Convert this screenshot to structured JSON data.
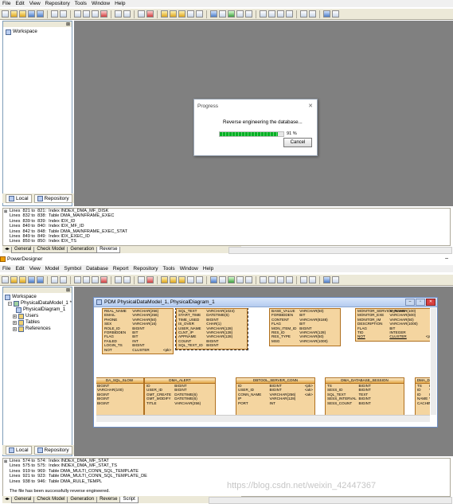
{
  "menu_top": [
    "File",
    "Edit",
    "View",
    "Repository",
    "Tools",
    "Window",
    "Help"
  ],
  "app_title": "PowerDesigner",
  "menu_bottom": [
    "File",
    "Edit",
    "View",
    "Model",
    "Symbol",
    "Database",
    "Report",
    "Repository",
    "Tools",
    "Window",
    "Help"
  ],
  "browser_top": {
    "root": "Workspace"
  },
  "browser_bottom": {
    "root": "Workspace",
    "model": "PhysicalDataModel_1 *",
    "items": [
      "PhysicalDiagram_1",
      "Users",
      "Tables",
      "References"
    ]
  },
  "browser_tabs": {
    "local": "Local",
    "repository": "Repository"
  },
  "progress_dialog": {
    "title": "Progress",
    "message": "Reverse engineering the database...",
    "percent_text": "91 %",
    "percent": 0.91,
    "cancel": "Cancel"
  },
  "output_top": [
    "Lines  821 to  821:  Index INDEX_DMA_MF_DISK",
    "Lines  832 to  838:  Table DMA_MAINFRAME_EXEC",
    "Lines  839 to  839:  Index IDX_ID",
    "Lines  840 to  840:  Index IDX_MF_ID",
    "Lines  842 to  848:  Table DMA_MAINFRAME_EXEC_STAT",
    "Lines  849 to  849:  Index IDX_EXEC_ID",
    "Lines  850 to  850:  Index IDX_TS"
  ],
  "output_tabs_top": [
    "General",
    "Check Model",
    "Generation",
    "Reverse"
  ],
  "diagram_window": {
    "title": "PDM PhysicalDataModel_1, PhysicalDiagram_1"
  },
  "entities": [
    {
      "rows": [
        [
          "REAL_NAME",
          "VARCHAR(256)",
          ""
        ],
        [
          "EMAIL",
          "VARCHAR(256)",
          ""
        ],
        [
          "PHONE",
          "VARCHAR(50)",
          ""
        ],
        [
          "SEX",
          "VARCHAR(16)",
          ""
        ],
        [
          "ROLE_ID",
          "BIGINT",
          ""
        ],
        [
          "FORBIDDEN",
          "BIT",
          ""
        ],
        [
          "FLAG",
          "BIT",
          ""
        ],
        [
          "FAILED",
          "INT",
          ""
        ],
        [
          "LOGIN_TS",
          "BIGINT",
          ""
        ],
        [
          "NOT",
          "CLUSTER",
          "<pk>"
        ]
      ]
    },
    {
      "rows": [
        [
          "SQL_TEXT",
          "VARCHAR(1024)",
          ""
        ],
        [
          "START_TIME",
          "DATETIME(6)",
          ""
        ],
        [
          "TIME_USED",
          "BIGINT",
          ""
        ],
        [
          "IS_OVER",
          "CHAR(1)",
          ""
        ],
        [
          "USER_NAME",
          "VARCHAR(128)",
          ""
        ],
        [
          "CLNT_IP",
          "VARCHAR(128)",
          ""
        ],
        [
          "APPNAME",
          "VARCHAR(128)",
          ""
        ],
        [
          "COUNT",
          "BIGINT",
          ""
        ],
        [
          "SQL_TEXT_ID",
          "BIGINT",
          ""
        ]
      ]
    },
    {
      "rows": [
        [
          "BASE_VALUE",
          "VARCHAR(50)",
          ""
        ],
        [
          "FORBIDDEN",
          "BIT",
          ""
        ],
        [
          "CONTENT",
          "VARCHAR(8188)",
          ""
        ],
        [
          "FLAG",
          "BIT",
          ""
        ],
        [
          "MON_ITEM_ID",
          "BIGINT",
          ""
        ],
        [
          "RES_ID",
          "VARCHAR(128)",
          ""
        ],
        [
          "RES_TYPE",
          "VARCHAR(50)",
          ""
        ],
        [
          "MSG",
          "VARCHAR(1000)",
          ""
        ]
      ]
    },
    {
      "rows": [
        [
          "MONITOR_SERVICE_NAME",
          "VARCHAR(100)",
          ""
        ],
        [
          "MONITOR_EXE",
          "VARCHAR(500)",
          ""
        ],
        [
          "MONITOR_IM",
          "VARCHAR(50)",
          ""
        ],
        [
          "DESCRIPTION",
          "VARCHAR(1000)",
          ""
        ],
        [
          "FLAG",
          "BIT",
          ""
        ],
        [
          "TID",
          "INTEGER",
          ""
        ],
        [
          "NOT",
          "CLUSTER",
          "<pk>"
        ]
      ]
    },
    {
      "title": "DA_SQL_SLOW",
      "rows": [
        [
          "BIGINT",
          "",
          ""
        ],
        [
          "VARCHAR(100)",
          "",
          ""
        ],
        [
          "BIGINT",
          "",
          ""
        ],
        [
          "BIGINT",
          "",
          ""
        ],
        [
          "BIGINT",
          "",
          ""
        ]
      ]
    },
    {
      "title": "DMA_ALERT",
      "rows": [
        [
          "ID",
          "BIGINT",
          ""
        ],
        [
          "USER_ID",
          "BIGINT",
          ""
        ],
        [
          "GMT_CREATE",
          "DATETIME(6)",
          ""
        ],
        [
          "GMT_MODIFY",
          "DATETIME(6)",
          ""
        ],
        [
          "TITLE",
          "VARCHAR(256)",
          ""
        ]
      ]
    },
    {
      "title": "DBTOOL_SERVER_CONN",
      "rows": [
        [
          "ID",
          "BIGINT",
          "<pk>"
        ],
        [
          "USER_ID",
          "BIGINT",
          "<ak>"
        ],
        [
          "CONN_NAME",
          "VARCHAR(256)",
          "<ak>"
        ],
        [
          "IP",
          "VARCHAR(128)",
          ""
        ],
        [
          "PORT",
          "INT",
          ""
        ]
      ]
    },
    {
      "title": "DMA_DATABASE_SESSION",
      "rows": [
        [
          "TS",
          "BIGINT",
          ""
        ],
        [
          "SESS_ID",
          "BIGINT",
          ""
        ],
        [
          "SQL_TEXT",
          "TEXT",
          ""
        ],
        [
          "SESS_INTERVAL",
          "BIGINT",
          ""
        ],
        [
          "SESS_COUNT",
          "BIGINT",
          ""
        ]
      ]
    },
    {
      "title": "DMA_DATABASE",
      "rows": [
        [
          "TS",
          "BIGINT",
          ""
        ],
        [
          "ID",
          "VARCH",
          ""
        ],
        [
          "ID",
          "INT",
          ""
        ],
        [
          "NAME",
          "VARCH",
          ""
        ],
        [
          "CACHE",
          "VARCH",
          ""
        ]
      ]
    }
  ],
  "output_bottom": [
    "Lines  574 to  574:  Index INDEX_DMA_MF_STAT",
    "Lines  575 to  575:  Index INDEX_DMA_MF_STAT_TS",
    "Lines  919 to  969:  Table DMA_MULTI_CONN_SQL_TEMPLATE",
    "Lines  921 to  923:  Table DMA_MULTI_CONN_SQL_TEMPLATE_DE",
    "Lines  938 to  946:  Table DMA_RULE_TEMPL",
    "",
    "The file has been successfully reverse engineered."
  ],
  "output_tabs_bottom": [
    "General",
    "Check Model",
    "Generation",
    "Reverse",
    "Script"
  ],
  "watermark": "https://blog.csdn.net/weixin_42447367"
}
